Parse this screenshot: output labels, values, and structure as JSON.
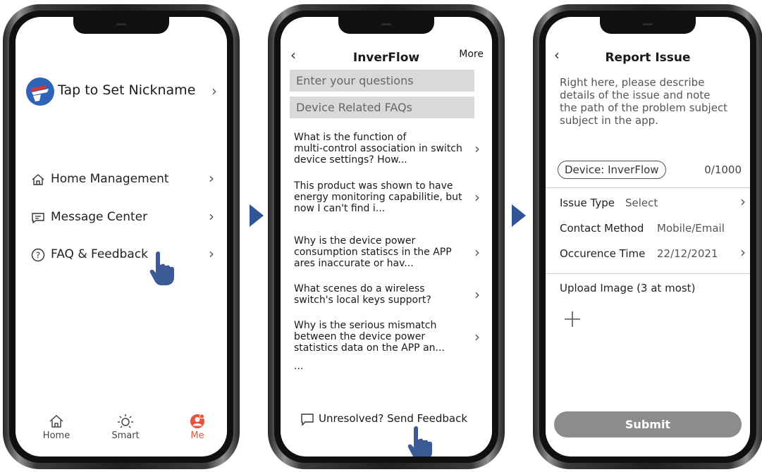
{
  "screen1": {
    "nickname": "Tap to Set Nickname",
    "menu": [
      {
        "label": "Home Management",
        "icon": "home-outline-icon"
      },
      {
        "label": "Message Center",
        "icon": "message-icon"
      },
      {
        "label": "FAQ & Feedback",
        "icon": "question-circle-icon"
      }
    ],
    "tabs": [
      {
        "label": "Home",
        "icon": "home-icon"
      },
      {
        "label": "Smart",
        "icon": "sun-icon"
      },
      {
        "label": "Me",
        "icon": "profile-icon",
        "active": true
      }
    ],
    "active_color": "#e2553c"
  },
  "screen2": {
    "title": "InverFlow",
    "more": "More",
    "search_placeholder": "Enter your questions",
    "section": "Device Related FAQs",
    "faqs": [
      {
        "lines": [
          "What is the function of",
          "multi-control association in switch",
          "device settings? How..."
        ]
      },
      {
        "lines": [
          "This product was shown to have",
          "energy monitoring capabilitie, but",
          "now I can't find i..."
        ]
      },
      {
        "lines": [
          "Why is the device power",
          "consumption statiscs in the APP",
          "ares inaccurate or hav..."
        ]
      },
      {
        "lines": [
          "What scenes do a wireless",
          "switch's local keys support?"
        ]
      },
      {
        "lines": [
          "Why is the serious mismatch",
          "between the device power",
          "statistics data on the APP an..."
        ]
      }
    ],
    "ellipsis": "...",
    "feedback": "Unresolved? Send Feedback"
  },
  "screen3": {
    "title": "Report Issue",
    "description_lines": [
      "Right here, please describe",
      "details of the issue and note",
      "the path of the problem subject",
      "subject in the app."
    ],
    "device_tag": "Device: InverFlow",
    "counter": "0/1000",
    "issue_type_label": "Issue Type",
    "issue_type_value": "Select",
    "contact_label": "Contact Method",
    "contact_value": "Mobile/Email",
    "time_label": "Occurence Time",
    "time_value": "22/12/2021",
    "upload_label": "Upload Image (3 at most)",
    "submit": "Submit"
  },
  "colors": {
    "arrow": "#2f5597",
    "hand": "#3c5a96",
    "submit_bg": "#8c8c8c",
    "logo_blue": "#2f63b8",
    "logo_red": "#e0332b"
  }
}
